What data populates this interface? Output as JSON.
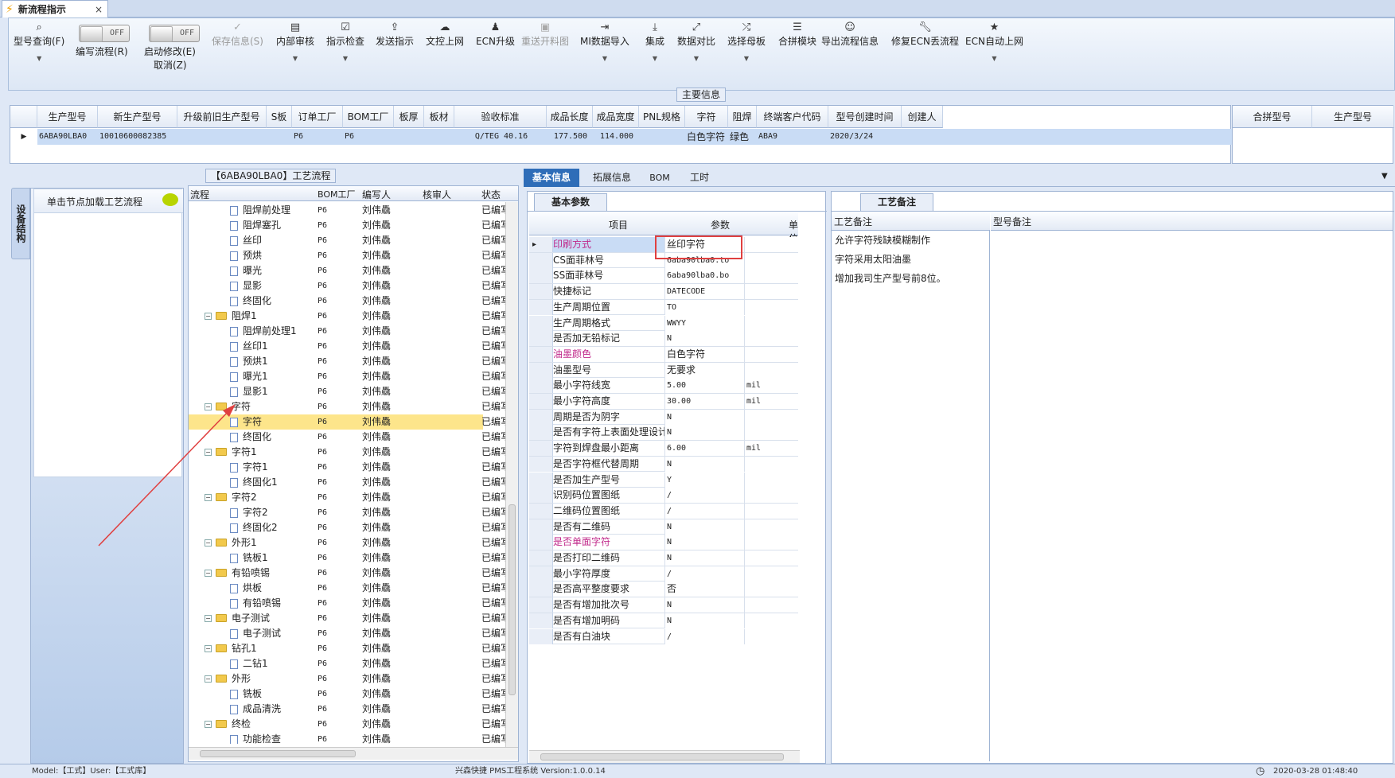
{
  "window": {
    "tab_title": "新流程指示",
    "close": "×"
  },
  "toolbar": {
    "btn_model_query": "型号查询(F)",
    "write_flow_label": "编写流程(R)",
    "toggle_off": "OFF",
    "start_modify_label": "启动修改(E)",
    "cancel_label": "取消(Z)",
    "btn_save": "保存信息(S)",
    "btn_internal_review": "内部审核",
    "btn_check": "指示检查",
    "btn_send": "发送指示",
    "btn_upload": "文控上网",
    "btn_ecn_upgrade": "ECN升级",
    "btn_reopen": "重送开料图",
    "btn_mi_import": "MI数据导入",
    "btn_integrate": "集成",
    "btn_compare": "数据对比",
    "btn_select_master": "选择母板",
    "btn_merge": "合拼模块",
    "btn_export": "导出流程信息",
    "btn_fix": "修复ECN丢流程",
    "btn_auto_upload": "ECN自动上网"
  },
  "main_info": {
    "title": "主要信息",
    "columns": [
      "生产型号",
      "新生产型号",
      "升级前旧生产型号",
      "S板",
      "订单工厂",
      "BOM工厂",
      "板厚",
      "板材",
      "验收标准",
      "成品长度",
      "成品宽度",
      "PNL规格",
      "字符",
      "阻焊",
      "终端客户代码",
      "型号创建时间",
      "创建人"
    ],
    "row": {
      "model": "6ABA90LBA0",
      "new_model": "10010600082385",
      "old_model": "",
      "s_board": "",
      "order_factory": "P6",
      "bom_factory": "P6",
      "thickness": "",
      "material": "",
      "standard": "Q/TEG 40.16",
      "length": "177.500",
      "width": "114.000",
      "pnl": "",
      "char": "白色字符",
      "solder": "绿色",
      "client": "ABA9",
      "created": "2020/3/24",
      "creator": ""
    },
    "merge_columns": [
      "合拼型号",
      "生产型号"
    ]
  },
  "left_panel": {
    "vertical_tab": "设备结构",
    "item": "单击节点加载工艺流程"
  },
  "flow_panel": {
    "title": "【6ABA90LBA0】工艺流程",
    "columns": [
      "流程",
      "BOM工厂",
      "编写人",
      "核审人",
      "状态"
    ],
    "rows": [
      {
        "level": 2,
        "type": "file",
        "name": "阻焊前处理",
        "factory": "P6",
        "writer": "刘伟驫",
        "status": "已编写"
      },
      {
        "level": 2,
        "type": "file",
        "name": "阻焊塞孔",
        "factory": "P6",
        "writer": "刘伟驫",
        "status": "已编写"
      },
      {
        "level": 2,
        "type": "file",
        "name": "丝印",
        "factory": "P6",
        "writer": "刘伟驫",
        "status": "已编写"
      },
      {
        "level": 2,
        "type": "file",
        "name": "预烘",
        "factory": "P6",
        "writer": "刘伟驫",
        "status": "已编写"
      },
      {
        "level": 2,
        "type": "file",
        "name": "曝光",
        "factory": "P6",
        "writer": "刘伟驫",
        "status": "已编写"
      },
      {
        "level": 2,
        "type": "file",
        "name": "显影",
        "factory": "P6",
        "writer": "刘伟驫",
        "status": "已编写"
      },
      {
        "level": 2,
        "type": "file",
        "name": "终固化",
        "factory": "P6",
        "writer": "刘伟驫",
        "status": "已编写"
      },
      {
        "level": 1,
        "type": "folder",
        "name": "阻焊1",
        "factory": "P6",
        "writer": "刘伟驫",
        "status": "已编写"
      },
      {
        "level": 2,
        "type": "file",
        "name": "阻焊前处理1",
        "factory": "P6",
        "writer": "刘伟驫",
        "status": "已编写"
      },
      {
        "level": 2,
        "type": "file",
        "name": "丝印1",
        "factory": "P6",
        "writer": "刘伟驫",
        "status": "已编写"
      },
      {
        "level": 2,
        "type": "file",
        "name": "预烘1",
        "factory": "P6",
        "writer": "刘伟驫",
        "status": "已编写"
      },
      {
        "level": 2,
        "type": "file",
        "name": "曝光1",
        "factory": "P6",
        "writer": "刘伟驫",
        "status": "已编写"
      },
      {
        "level": 2,
        "type": "file",
        "name": "显影1",
        "factory": "P6",
        "writer": "刘伟驫",
        "status": "已编写"
      },
      {
        "level": 1,
        "type": "folder",
        "name": "字符",
        "factory": "P6",
        "writer": "刘伟驫",
        "status": "已编写"
      },
      {
        "level": 2,
        "type": "file",
        "name": "字符",
        "factory": "P6",
        "writer": "刘伟驫",
        "status": "已编写",
        "selected": true
      },
      {
        "level": 2,
        "type": "file",
        "name": "终固化",
        "factory": "P6",
        "writer": "刘伟驫",
        "status": "已编写"
      },
      {
        "level": 1,
        "type": "folder",
        "name": "字符1",
        "factory": "P6",
        "writer": "刘伟驫",
        "status": "已编写"
      },
      {
        "level": 2,
        "type": "file",
        "name": "字符1",
        "factory": "P6",
        "writer": "刘伟驫",
        "status": "已编写"
      },
      {
        "level": 2,
        "type": "file",
        "name": "终固化1",
        "factory": "P6",
        "writer": "刘伟驫",
        "status": "已编写"
      },
      {
        "level": 1,
        "type": "folder",
        "name": "字符2",
        "factory": "P6",
        "writer": "刘伟驫",
        "status": "已编写"
      },
      {
        "level": 2,
        "type": "file",
        "name": "字符2",
        "factory": "P6",
        "writer": "刘伟驫",
        "status": "已编写"
      },
      {
        "level": 2,
        "type": "file",
        "name": "终固化2",
        "factory": "P6",
        "writer": "刘伟驫",
        "status": "已编写"
      },
      {
        "level": 1,
        "type": "folder",
        "name": "外形1",
        "factory": "P6",
        "writer": "刘伟驫",
        "status": "已编写"
      },
      {
        "level": 2,
        "type": "file",
        "name": "铣板1",
        "factory": "P6",
        "writer": "刘伟驫",
        "status": "已编写"
      },
      {
        "level": 1,
        "type": "folder",
        "name": "有铅喷锡",
        "factory": "P6",
        "writer": "刘伟驫",
        "status": "已编写"
      },
      {
        "level": 2,
        "type": "file",
        "name": "烘板",
        "factory": "P6",
        "writer": "刘伟驫",
        "status": "已编写"
      },
      {
        "level": 2,
        "type": "file",
        "name": "有铅喷锡",
        "factory": "P6",
        "writer": "刘伟驫",
        "status": "已编写"
      },
      {
        "level": 1,
        "type": "folder",
        "name": "电子测试",
        "factory": "P6",
        "writer": "刘伟驫",
        "status": "已编写"
      },
      {
        "level": 2,
        "type": "file",
        "name": "电子测试",
        "factory": "P6",
        "writer": "刘伟驫",
        "status": "已编写"
      },
      {
        "level": 1,
        "type": "folder",
        "name": "钻孔1",
        "factory": "P6",
        "writer": "刘伟驫",
        "status": "已编写"
      },
      {
        "level": 2,
        "type": "file",
        "name": "二钻1",
        "factory": "P6",
        "writer": "刘伟驫",
        "status": "已编写"
      },
      {
        "level": 1,
        "type": "folder",
        "name": "外形",
        "factory": "P6",
        "writer": "刘伟驫",
        "status": "已编写"
      },
      {
        "level": 2,
        "type": "file",
        "name": "铣板",
        "factory": "P6",
        "writer": "刘伟驫",
        "status": "已编写"
      },
      {
        "level": 2,
        "type": "file",
        "name": "成品清洗",
        "factory": "P6",
        "writer": "刘伟驫",
        "status": "已编写"
      },
      {
        "level": 1,
        "type": "folder",
        "name": "终检",
        "factory": "P6",
        "writer": "刘伟驫",
        "status": "已编写"
      },
      {
        "level": 2,
        "type": "file",
        "name": "功能检查",
        "factory": "P6",
        "writer": "刘伟驫",
        "status": "已编写"
      }
    ]
  },
  "detail_tabs": [
    "基本信息",
    "拓展信息",
    "BOM",
    "工时"
  ],
  "params_panel": {
    "tab": "基本参数",
    "columns": [
      "项目",
      "参数",
      "单位"
    ],
    "rows": [
      {
        "key": "印刷方式",
        "value": "丝印字符",
        "unit": "",
        "highlight": true
      },
      {
        "key": "CS面菲林号",
        "value": "6aba90lba0.to",
        "unit": ""
      },
      {
        "key": "SS面菲林号",
        "value": "6aba90lba0.bo",
        "unit": ""
      },
      {
        "key": "快捷标记",
        "value": "DATECODE",
        "unit": ""
      },
      {
        "key": "生产周期位置",
        "value": "TO",
        "unit": ""
      },
      {
        "key": "生产周期格式",
        "value": "WWYY",
        "unit": ""
      },
      {
        "key": "是否加无铅标记",
        "value": "N",
        "unit": ""
      },
      {
        "key": "油墨颜色",
        "value": "白色字符",
        "unit": "",
        "highlight": true
      },
      {
        "key": "油墨型号",
        "value": "无要求",
        "unit": ""
      },
      {
        "key": "最小字符线宽",
        "value": "5.00",
        "unit": "mil"
      },
      {
        "key": "最小字符高度",
        "value": "30.00",
        "unit": "mil"
      },
      {
        "key": "周期是否为阴字",
        "value": "N",
        "unit": ""
      },
      {
        "key": "是否有字符上表面处理设计",
        "value": "N",
        "unit": ""
      },
      {
        "key": "字符到焊盘最小距离",
        "value": "6.00",
        "unit": "mil"
      },
      {
        "key": "是否字符框代替周期",
        "value": "N",
        "unit": ""
      },
      {
        "key": "是否加生产型号",
        "value": "Y",
        "unit": ""
      },
      {
        "key": "识别码位置图纸",
        "value": "/",
        "unit": ""
      },
      {
        "key": "二维码位置图纸",
        "value": "/",
        "unit": ""
      },
      {
        "key": "是否有二维码",
        "value": "N",
        "unit": ""
      },
      {
        "key": "是否单面字符",
        "value": "N",
        "unit": "",
        "highlight": true
      },
      {
        "key": "是否打印二维码",
        "value": "N",
        "unit": ""
      },
      {
        "key": "最小字符厚度",
        "value": "/",
        "unit": ""
      },
      {
        "key": "是否高平整度要求",
        "value": "否",
        "unit": ""
      },
      {
        "key": "是否有增加批次号",
        "value": "N",
        "unit": ""
      },
      {
        "key": "是否有增加明码",
        "value": "N",
        "unit": ""
      },
      {
        "key": "是否有白油块",
        "value": "/",
        "unit": ""
      }
    ]
  },
  "notes_panel": {
    "tab": "工艺备注",
    "col1": "工艺备注",
    "col2": "型号备注",
    "notes": [
      "允许字符残缺模糊制作",
      "字符采用太阳油墨",
      "增加我司生产型号前8位。"
    ]
  },
  "status_bar": {
    "left": "Model:【工式】User:【工式库】",
    "center": "兴森快捷 PMS工程系统 Version:1.0.0.14",
    "right": "2020-03-28 01:48:40"
  },
  "colors": {
    "highlight_key": "#c0288a",
    "selection": "#fde58b",
    "annotation_red": "#e04040",
    "header_blue": "#9fb4d4"
  }
}
